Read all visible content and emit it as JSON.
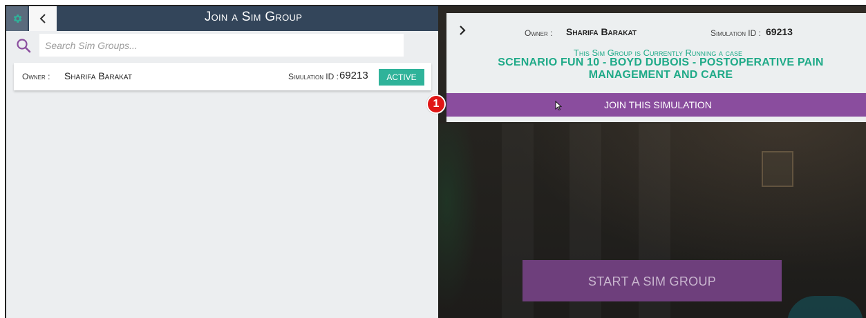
{
  "left_panel": {
    "title": "Join a Sim Group",
    "search": {
      "placeholder": "Search Sim Groups...",
      "value": ""
    },
    "groups": [
      {
        "owner_label": "Owner :",
        "owner_name": "Sharifa Barakat",
        "sim_id_label": "Simulation ID :",
        "sim_id": "69213",
        "status": "ACTIVE"
      }
    ]
  },
  "detail_popup": {
    "owner_label": "Owner :",
    "owner_name": "Sharifa Barakat",
    "sim_id_label": "Simulation ID :",
    "sim_id": "69213",
    "running_text": "This Sim Group is Currently Running a case",
    "scenario_name": "SCENARIO FUN 10 - BOYD DUBOIS - POSTOPERATIVE PAIN MANAGEMENT AND CARE",
    "join_label": "JOIN THIS SIMULATION"
  },
  "start_button_label": "START A SIM GROUP",
  "step_marker": "1",
  "icons": {
    "settings": "gear-icon",
    "back": "chevron-left-icon",
    "search": "search-icon",
    "collapse": "chevron-right-icon",
    "cursor": "mouse-pointer-icon"
  },
  "colors": {
    "topbar": "#33455a",
    "active": "#2fb39a",
    "accent_text": "#1faa88",
    "join_button": "#8a4d9e",
    "start_button": "#6e3f7c",
    "step_marker": "#e01616"
  }
}
